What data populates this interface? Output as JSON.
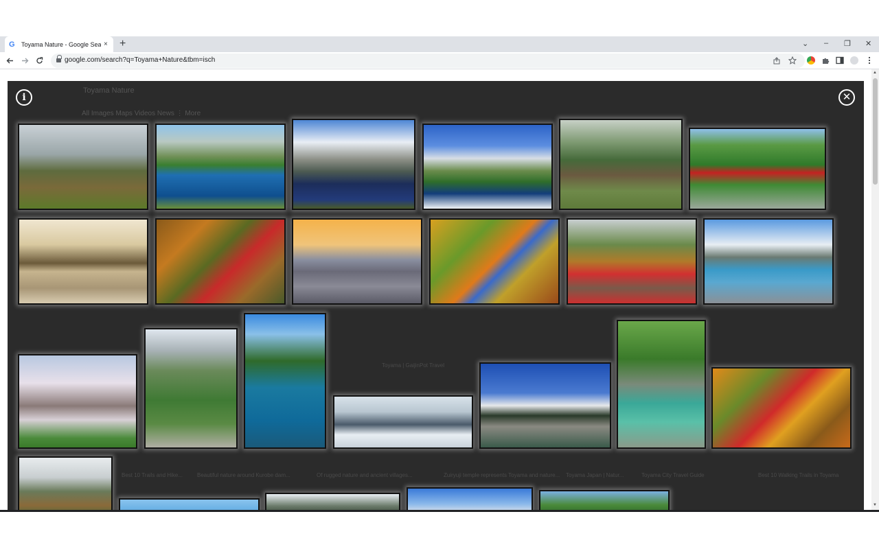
{
  "browser": {
    "tab_title": "Toyama Nature - Google Sear",
    "tab_icon": "G",
    "tab_close": "×",
    "new_tab": "+",
    "url": "google.com/search?q=Toyama+Nature&tbm=isch",
    "window_controls": [
      "⌄",
      "–",
      "❐",
      "✕"
    ]
  },
  "background": {
    "search_query": "Toyama Nature",
    "tabs": "All   Images   Maps   Videos   News   ⋮ More",
    "captions": [
      "Toyama | GaijinPot Travel",
      "Best 10 Trails and Hike...",
      "Beautiful nature around Kurobe dam...",
      "Of rugged nature and ancient villages...",
      "Zuiryuji temple represents Toyama and nature...",
      "Toyama Japan | Natur...",
      "Toyama City Travel Guide",
      "Best 10 Walking Trails in Toyama"
    ]
  },
  "viewer": {
    "info_icon": "i",
    "close_icon": "✕"
  },
  "colors": {
    "overlay": "#2b2b2b",
    "tabstrip": "#dee1e6",
    "omnibox": "#f1f3f4"
  },
  "thumbnails": [
    {
      "name": "thumb-village-fog"
    },
    {
      "name": "thumb-blue-lake"
    },
    {
      "name": "thumb-mountain-reflection"
    },
    {
      "name": "thumb-alpine-pond"
    },
    {
      "name": "thumb-gassho-village"
    },
    {
      "name": "thumb-red-bridge-gorge"
    },
    {
      "name": "thumb-sea-rock-sunrise"
    },
    {
      "name": "thumb-autumn-red-bridge"
    },
    {
      "name": "thumb-city-sunset-mountains"
    },
    {
      "name": "thumb-ropeway-autumn"
    },
    {
      "name": "thumb-red-walkway"
    },
    {
      "name": "thumb-dam-lake"
    },
    {
      "name": "thumb-cherry-blossom"
    },
    {
      "name": "thumb-green-ridge"
    },
    {
      "name": "thumb-boat-gorge"
    },
    {
      "name": "thumb-snow-river"
    },
    {
      "name": "thumb-toyama-castle"
    },
    {
      "name": "thumb-emerald-river"
    },
    {
      "name": "thumb-autumn-train-bridge"
    },
    {
      "name": "thumb-misty-peaks"
    },
    {
      "name": "thumb-bottom-sky"
    },
    {
      "name": "thumb-bottom-snowy-range"
    },
    {
      "name": "thumb-bottom-castle"
    },
    {
      "name": "thumb-bottom-green-hills"
    }
  ]
}
